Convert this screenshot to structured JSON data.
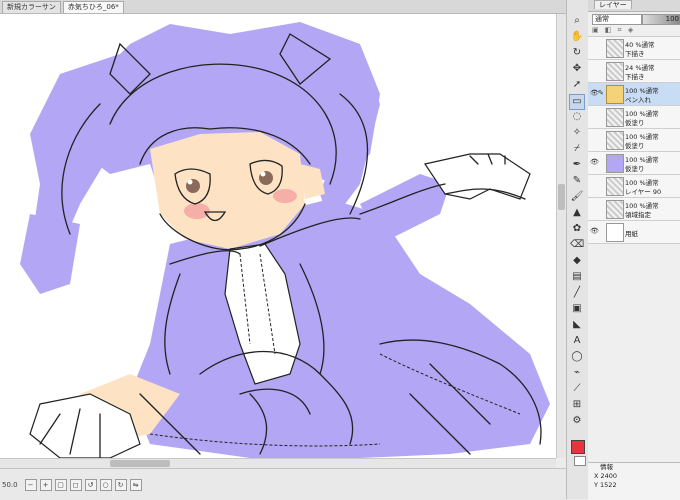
{
  "tabs": [
    {
      "label": "新規カラーサン",
      "active": false
    },
    {
      "label": "赤気ちひろ_06*",
      "active": true
    }
  ],
  "status": {
    "zoom": "50.0"
  },
  "layer_panel": {
    "tab_label": "レイヤー",
    "blend_mode": "通常",
    "opacity": "100",
    "layers": [
      {
        "line1": "40 %通常",
        "line2": "下描き",
        "type": "raster",
        "selected": false,
        "visible": false
      },
      {
        "line1": "24 %通常",
        "line2": "下描き",
        "type": "raster",
        "selected": false,
        "visible": false
      },
      {
        "line1": "100 %通常",
        "line2": "ペン入れ",
        "type": "folder",
        "selected": true,
        "visible": true
      },
      {
        "line1": "100 %通常",
        "line2": "仮塗り",
        "type": "raster",
        "selected": false,
        "visible": false
      },
      {
        "line1": "100 %通常",
        "line2": "仮塗り",
        "type": "raster",
        "selected": false,
        "visible": false
      },
      {
        "line1": "100 %通常",
        "line2": "仮塗り",
        "type": "raster",
        "selected": false,
        "visible": true
      },
      {
        "line1": "100 %通常",
        "line2": "レイヤー 90",
        "type": "raster",
        "selected": false,
        "visible": false
      },
      {
        "line1": "100 %通常",
        "line2": "領域指定",
        "type": "raster",
        "selected": false,
        "visible": false
      },
      {
        "line1": "",
        "line2": "用紙",
        "type": "paper",
        "selected": false,
        "visible": true
      }
    ],
    "info": {
      "title": "情報",
      "x": "X 2400",
      "y": "Y 1522"
    }
  },
  "colors": {
    "main": "#e5353d",
    "sub": "#ffffff",
    "paint": "#b3a6f4"
  },
  "tools": [
    "zoom-icon",
    "hand-icon",
    "rotate-icon",
    "move-icon",
    "layer-move-icon",
    "selection-rect-icon",
    "lasso-icon",
    "magic-wand-icon",
    "eyedropper-icon",
    "pen-icon",
    "pencil-icon",
    "brush-icon",
    "airbrush-icon",
    "decoration-icon",
    "eraser-icon",
    "fill-icon",
    "gradient-icon",
    "figure-icon",
    "frame-icon",
    "ruler-icon",
    "text-icon",
    "balloon-icon",
    "line-fix-icon",
    "correction-icon",
    "sub-tool-icon"
  ]
}
